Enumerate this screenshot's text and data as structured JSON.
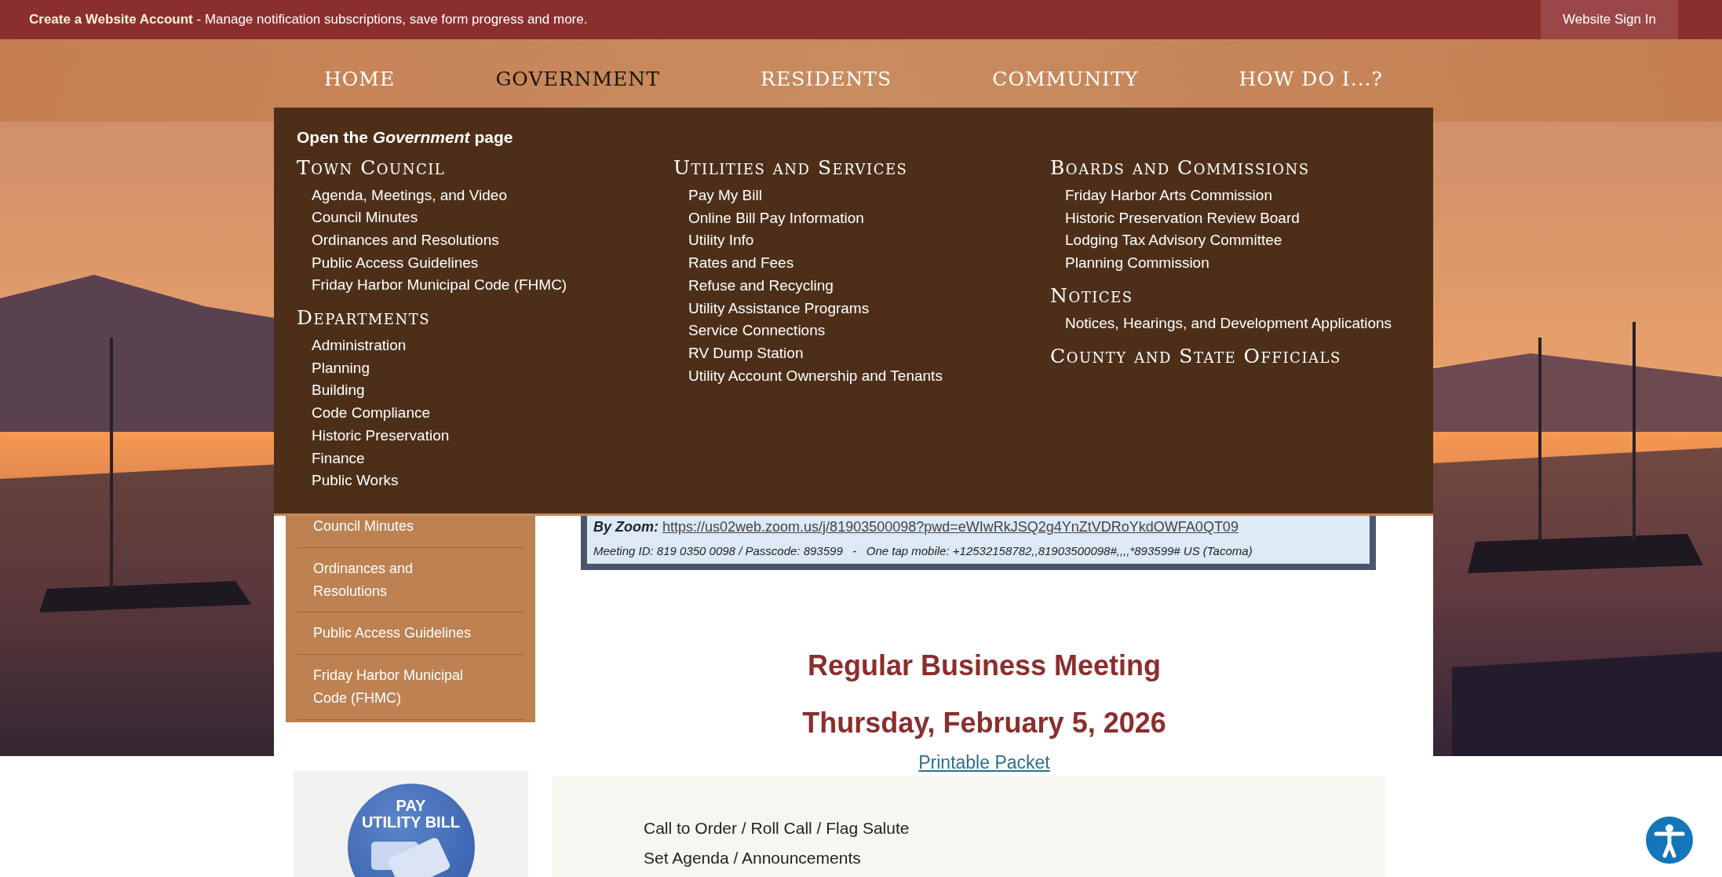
{
  "top_bar": {
    "message": "**Create a Website Account** - Manage notification subscriptions, save form progress and more.",
    "sign_in": "Website Sign In"
  },
  "nav": [
    {
      "label": "HOME",
      "selected": false
    },
    {
      "label": "GOVERNMENT",
      "selected": true
    },
    {
      "label": "RESIDENTS",
      "selected": false
    },
    {
      "label": "COMMUNITY",
      "selected": false
    },
    {
      "label": "HOW DO I...?",
      "selected": false
    }
  ],
  "mega_menu": {
    "open_link": "Open the *Government* page",
    "columns": [
      {
        "sections": [
          {
            "heading": "Town Council",
            "items": [
              "Agenda, Meetings, and Video",
              "Council Minutes",
              "Ordinances and Resolutions",
              "Public Access Guidelines",
              "Friday Harbor Municipal Code (FHMC)"
            ]
          },
          {
            "heading": "Departments",
            "items": [
              "Administration",
              "Planning",
              "Building",
              "Code Compliance",
              "Historic Preservation",
              "Finance",
              "Public Works"
            ]
          }
        ]
      },
      {
        "sections": [
          {
            "heading": "Utilities and Services",
            "items": [
              "Pay My Bill",
              "Online Bill Pay Information",
              "Utility Info",
              "Rates and Fees",
              "Refuse and Recycling",
              "Utility Assistance Programs",
              "Service Connections",
              "RV Dump Station",
              "Utility Account Ownership and Tenants"
            ]
          }
        ]
      },
      {
        "sections": [
          {
            "heading": "Boards and Commissions",
            "items": [
              "Friday Harbor Arts Commission",
              "Historic Preservation Review Board",
              "Lodging Tax Advisory Committee",
              "Planning Commission"
            ]
          },
          {
            "heading": "Notices",
            "items": [
              "Notices, Hearings, and Development Applications"
            ]
          },
          {
            "heading": "County and State Officials"
          }
        ]
      }
    ]
  },
  "sidebar": {
    "items": [
      "Council Minutes",
      "Ordinances and Resolutions",
      "Public Access Guidelines",
      "Friday Harbor Municipal Code (FHMC)"
    ]
  },
  "promo": {
    "line_1": "PAY",
    "line_2": "UTILITY BILL"
  },
  "meeting_info": {
    "zoom_label": "By Zoom:",
    "zoom_link": "https://us02web.zoom.us/j/81903500098?pwd=eWIwRkJSQ2g4YnZtVDRoYkdOWFA0QT09",
    "details": "Meeting ID: 819 0350 0098 / Passcode: 893599   -   One tap mobile: +12532158782,,81903500098#,,,,*893599# US (Tacoma)"
  },
  "meeting": {
    "title": "Regular Business Meeting",
    "date": "Thursday, February 5, 2026",
    "packet_link": "Printable Packet",
    "agenda": [
      "Call to Order / Roll Call / Flag Salute",
      "Set Agenda / Announcements"
    ]
  }
}
